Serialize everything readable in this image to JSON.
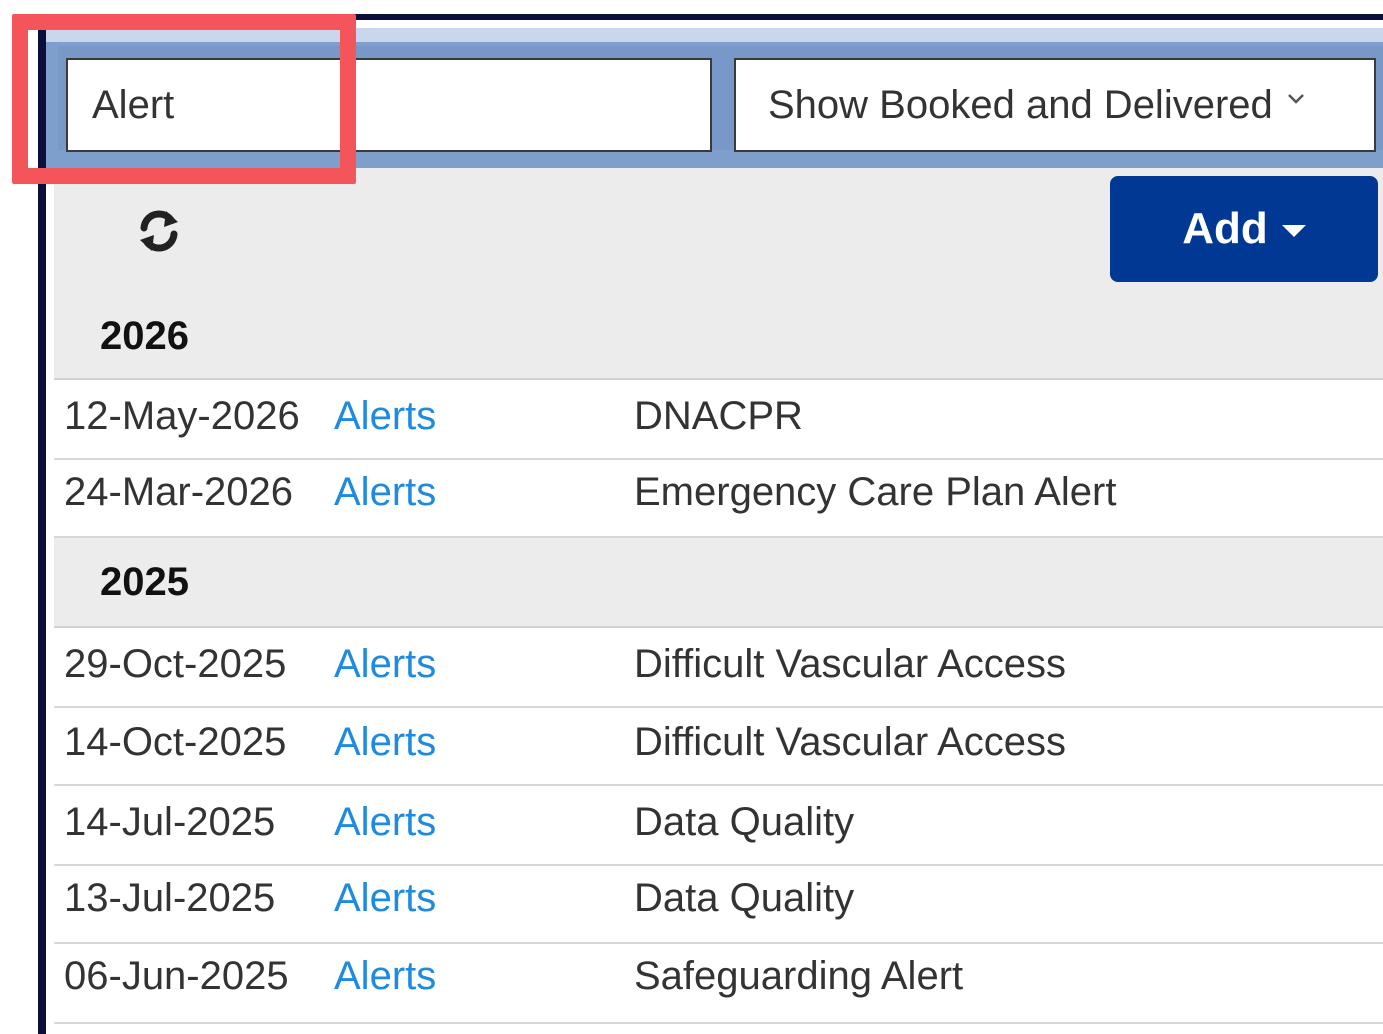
{
  "search": {
    "value": "Alert"
  },
  "filter_select": {
    "selected": "Show Booked and Delivered"
  },
  "toolbar": {
    "refresh_icon": "refresh-icon",
    "add_label": "Add"
  },
  "colors": {
    "accent": "#003893",
    "link": "#1e8be0",
    "highlight": "#f4555a",
    "filter_bar": "#7898c7"
  },
  "groups": [
    {
      "year": "2026",
      "rows": [
        {
          "date": "12-May-2026",
          "category": "Alerts",
          "description": "DNACPR"
        },
        {
          "date": "24-Mar-2026",
          "category": "Alerts",
          "description": "Emergency Care Plan Alert"
        }
      ]
    },
    {
      "year": "2025",
      "rows": [
        {
          "date": "29-Oct-2025",
          "category": "Alerts",
          "description": "Difficult Vascular Access"
        },
        {
          "date": "14-Oct-2025",
          "category": "Alerts",
          "description": "Difficult Vascular Access"
        },
        {
          "date": "14-Jul-2025",
          "category": "Alerts",
          "description": "Data Quality"
        },
        {
          "date": "13-Jul-2025",
          "category": "Alerts",
          "description": "Data Quality"
        },
        {
          "date": "06-Jun-2025",
          "category": "Alerts",
          "description": "Safeguarding Alert"
        }
      ]
    }
  ]
}
